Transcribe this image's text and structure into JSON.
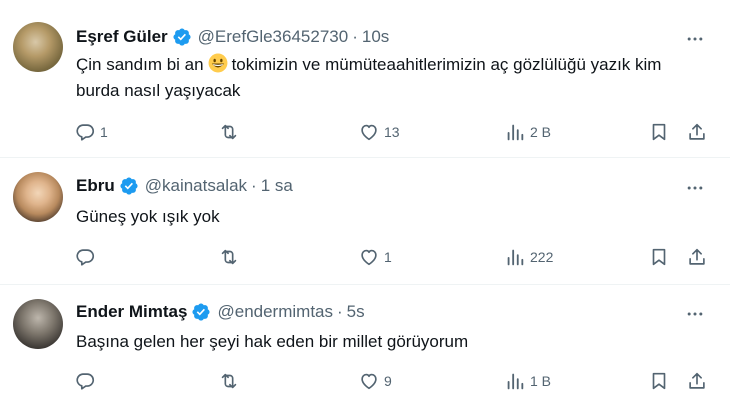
{
  "tweets": [
    {
      "name": "Eşref Güler",
      "handle": "@ErefGle36452730",
      "separator": "·",
      "time": "10s",
      "text_before": "Çin sandım bi an",
      "text_after": "tokimizin ve mümüteaahitlerimizin aç gözlülüğü yazık kim burda nasıl yaşıyacak",
      "emoji": "grinning-face-emoji",
      "reply_count": "1",
      "retweet_count": "",
      "like_count": "13",
      "view_count": "2 B"
    },
    {
      "name": "Ebru",
      "handle": "@kainatsalak",
      "separator": "·",
      "time": "1 sa",
      "text": "Güneş yok ışık yok",
      "reply_count": "",
      "retweet_count": "",
      "like_count": "1",
      "view_count": "222"
    },
    {
      "name": "Ender Mimtaş",
      "handle": "@endermimtas",
      "separator": "·",
      "time": "5s",
      "text": "Başına gelen her şeyi hak eden bir millet görüyorum",
      "reply_count": "",
      "retweet_count": "",
      "like_count": "9",
      "view_count": "1 B"
    }
  ],
  "colors": {
    "text": "#0f1419",
    "secondary": "#536471",
    "verified": "#1d9bf0",
    "divider": "#eff3f4"
  },
  "icons": [
    "more-icon",
    "verified-badge-icon",
    "reply-icon",
    "retweet-icon",
    "like-icon",
    "views-icon",
    "bookmark-icon",
    "share-icon"
  ]
}
